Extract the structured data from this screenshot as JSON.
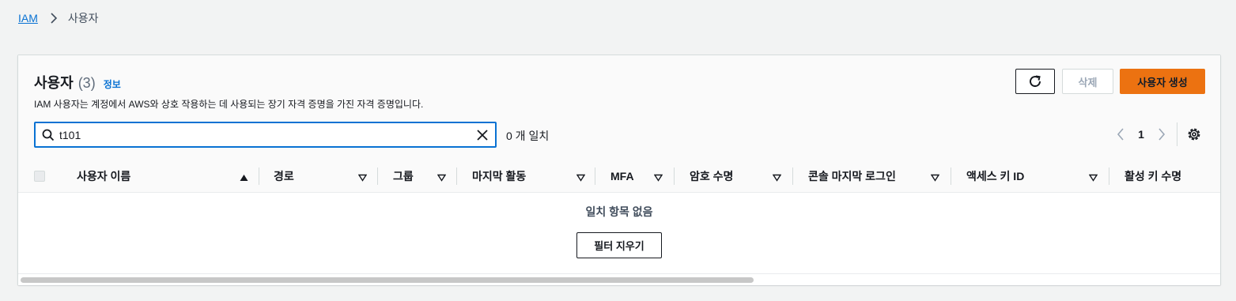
{
  "breadcrumb": {
    "root": "IAM",
    "current": "사용자"
  },
  "header": {
    "title": "사용자",
    "count": "(3)",
    "info": "정보",
    "description": "IAM 사용자는 계정에서 AWS와 상호 작용하는 데 사용되는 장기 자격 증명을 가진 자격 증명입니다."
  },
  "actions": {
    "refresh_icon": "refresh-icon",
    "delete_label": "삭제",
    "create_label": "사용자 생성"
  },
  "search": {
    "value": "t101",
    "match_count": "0 개 일치"
  },
  "pagination": {
    "current_page": "1"
  },
  "table": {
    "columns": [
      {
        "label": "사용자 이름",
        "sort": "ascending"
      },
      {
        "label": "경로",
        "sort": "none"
      },
      {
        "label": "그룹",
        "sort": "none"
      },
      {
        "label": "마지막 활동",
        "sort": "none"
      },
      {
        "label": "MFA",
        "sort": "none"
      },
      {
        "label": "암호 수명",
        "sort": "none"
      },
      {
        "label": "콘솔 마지막 로그인",
        "sort": "none"
      },
      {
        "label": "액세스 키 ID",
        "sort": "none"
      },
      {
        "label": "활성 키 수명",
        "sort": "none"
      }
    ],
    "empty_message": "일치 항목 없음",
    "clear_filter_label": "필터 지우기"
  },
  "colors": {
    "accent": "#0972d3",
    "primary_button": "#ec7211"
  }
}
